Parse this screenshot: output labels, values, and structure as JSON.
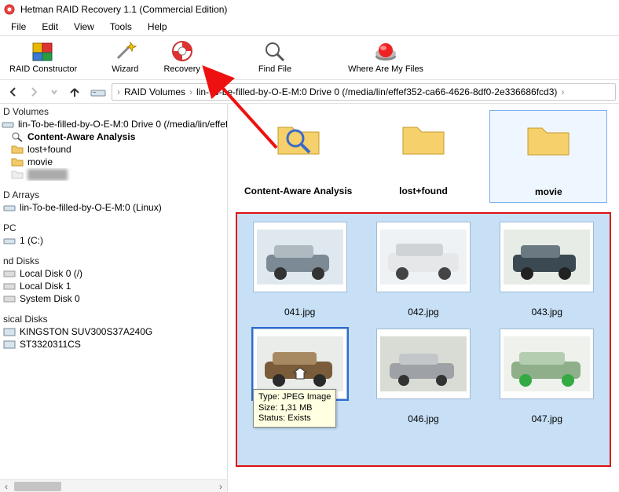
{
  "window": {
    "title": "Hetman RAID Recovery 1.1 (Commercial Edition)"
  },
  "menu": {
    "items": [
      "File",
      "Edit",
      "View",
      "Tools",
      "Help"
    ]
  },
  "toolbar": {
    "raid_constructor": "RAID Constructor",
    "wizard": "Wizard",
    "recovery": "Recovery",
    "find_file": "Find File",
    "where_files": "Where Are My Files"
  },
  "breadcrumb": {
    "parts": [
      "RAID Volumes",
      "lin-To-be-filled-by-O-E-M:0 Drive 0 (/media/lin/effef352-ca66-4626-8df0-2e336686fcd3)"
    ]
  },
  "tree": {
    "volumes_header": "D Volumes",
    "volume_path": "lin-To-be-filled-by-O-E-M:0 Drive 0 (/media/lin/effef",
    "content_aware": "Content-Aware Analysis",
    "lost_found": "lost+found",
    "movie": "movie",
    "arrays_header": "D Arrays",
    "array1": "lin-To-be-filled-by-O-E-M:0 (Linux)",
    "pc_header": "PC",
    "pc_item": "1 (C:)",
    "nd_disks_header": "nd Disks",
    "local_disk0": "Local Disk 0 (/)",
    "local_disk1": "Local Disk 1",
    "system_disk0": "System Disk 0",
    "physical_header": "sical Disks",
    "phys1": "KINGSTON SUV300S37A240G",
    "phys2": "ST3320311CS"
  },
  "folders": [
    {
      "name": "Content-Aware Analysis",
      "icon": "search"
    },
    {
      "name": "lost+found",
      "icon": "folder"
    },
    {
      "name": "movie",
      "icon": "folder",
      "selected": true
    }
  ],
  "files": [
    {
      "name": "041.jpg"
    },
    {
      "name": "042.jpg"
    },
    {
      "name": "043.jpg"
    },
    {
      "name": "",
      "selected": true
    },
    {
      "name": "046.jpg"
    },
    {
      "name": "047.jpg"
    }
  ],
  "tooltip": {
    "line1": "Type: JPEG Image",
    "line2": "Size: 1,31 MB",
    "line3": "Status: Exists"
  }
}
